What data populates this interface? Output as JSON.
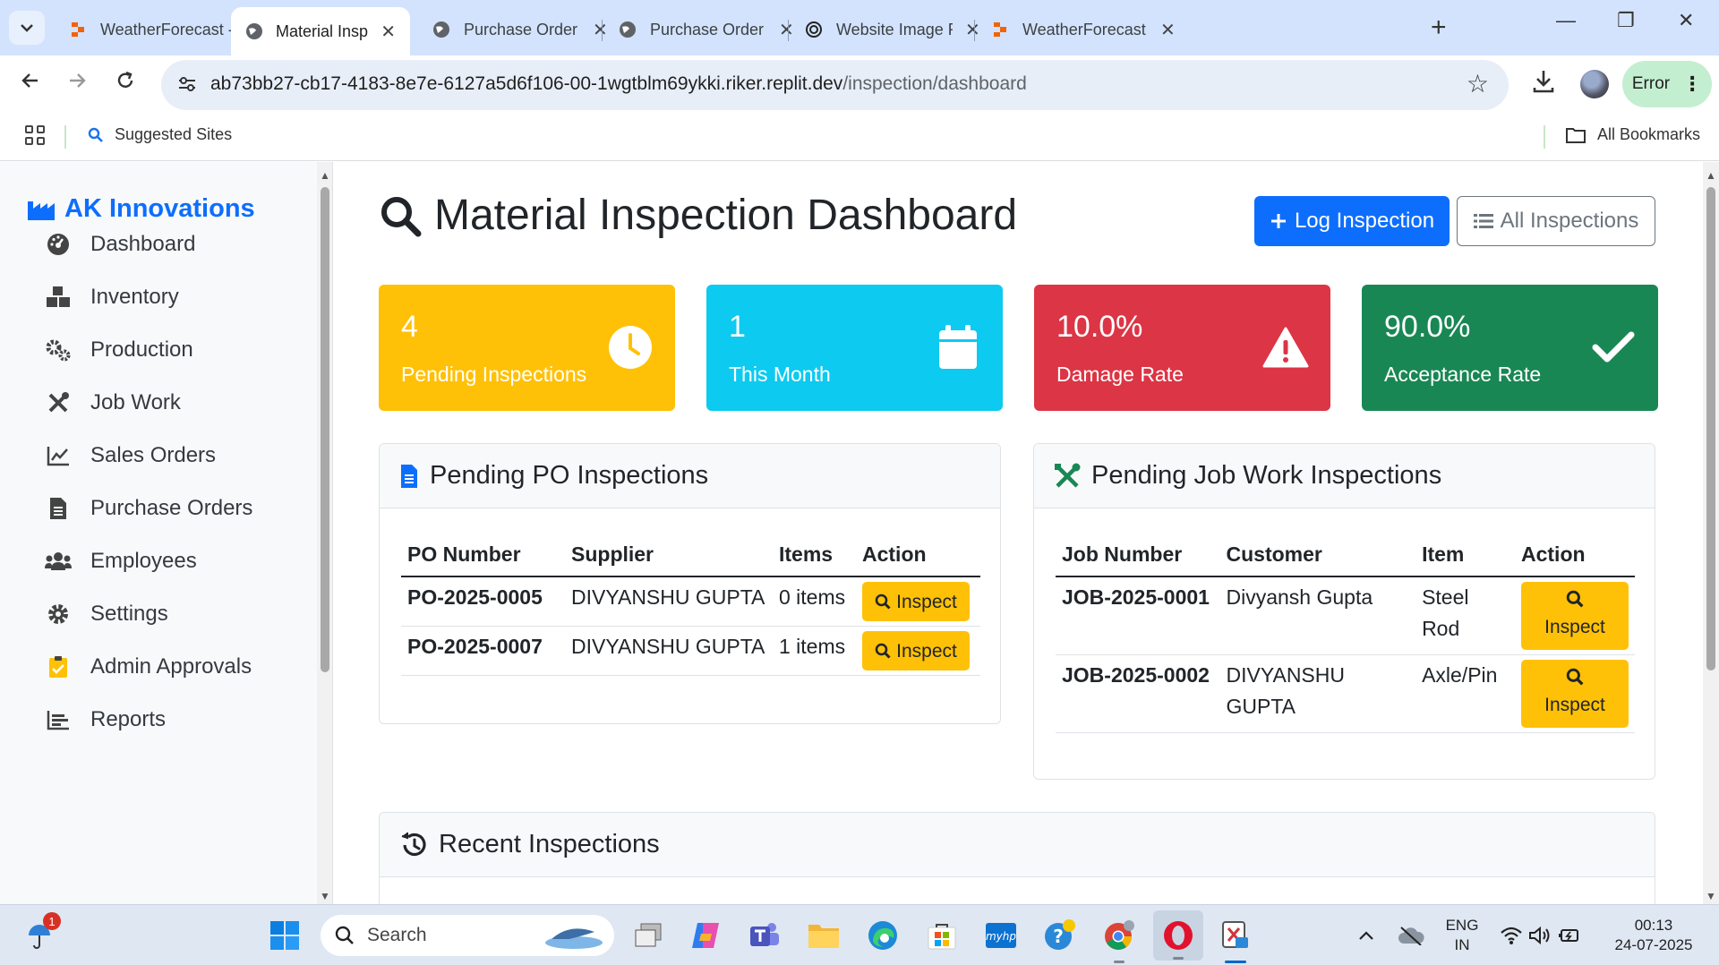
{
  "browser": {
    "tabs": [
      {
        "title": "WeatherForecast -",
        "icon": "replit-icon"
      },
      {
        "title": "Material Inspection",
        "icon": "globe-icon",
        "active": true
      },
      {
        "title": "Purchase Order - P",
        "icon": "globe-icon"
      },
      {
        "title": "Purchase Order - P",
        "icon": "globe-icon"
      },
      {
        "title": "Website Image Rec",
        "icon": "openai-icon"
      },
      {
        "title": "WeatherForecast -",
        "icon": "replit-icon"
      }
    ],
    "url_host": "ab73bb27-cb17-4183-8e7e-6127a5d6f106-00-1wgtblm69ykki.riker.replit.dev",
    "url_path": "/inspection/dashboard",
    "profile_status": "Error",
    "bookmarks": {
      "suggested": "Suggested Sites",
      "all": "All Bookmarks"
    }
  },
  "sidebar": {
    "brand": "AK Innovations",
    "items": [
      {
        "label": "Dashboard",
        "icon": "gauge-icon"
      },
      {
        "label": "Inventory",
        "icon": "boxes-icon"
      },
      {
        "label": "Production",
        "icon": "cogs-icon"
      },
      {
        "label": "Job Work",
        "icon": "tools-icon"
      },
      {
        "label": "Sales Orders",
        "icon": "line-chart-icon"
      },
      {
        "label": "Purchase Orders",
        "icon": "document-icon"
      },
      {
        "label": "Employees",
        "icon": "users-icon"
      },
      {
        "label": "Settings",
        "icon": "gear-icon"
      },
      {
        "label": "Admin Approvals",
        "icon": "clipboard-check-icon"
      },
      {
        "label": "Reports",
        "icon": "bar-chart-icon"
      }
    ]
  },
  "header": {
    "title": "Material Inspection Dashboard",
    "log_button": "Log Inspection",
    "all_button": "All Inspections"
  },
  "stats": [
    {
      "value": "4",
      "label": "Pending Inspections",
      "color": "#ffc107",
      "icon": "clock-icon"
    },
    {
      "value": "1",
      "label": "This Month",
      "color": "#0dcaf0",
      "icon": "calendar-icon"
    },
    {
      "value": "10.0%",
      "label": "Damage Rate",
      "color": "#dc3545",
      "icon": "warning-icon"
    },
    {
      "value": "90.0%",
      "label": "Acceptance Rate",
      "color": "#198754",
      "icon": "check-icon"
    }
  ],
  "po_card": {
    "title": "Pending PO Inspections",
    "columns": [
      "PO Number",
      "Supplier",
      "Items",
      "Action"
    ],
    "rows": [
      {
        "po": "PO-2025-0005",
        "supplier": "DIVYANSHU GUPTA",
        "items": "0 items",
        "action": "Inspect"
      },
      {
        "po": "PO-2025-0007",
        "supplier": "DIVYANSHU GUPTA",
        "items": "1 items",
        "action": "Inspect"
      }
    ]
  },
  "job_card": {
    "title": "Pending Job Work Inspections",
    "columns": [
      "Job Number",
      "Customer",
      "Item",
      "Action"
    ],
    "rows": [
      {
        "job": "JOB-2025-0001",
        "customer": "Divyansh Gupta",
        "item": "Steel Rod",
        "action": "Inspect"
      },
      {
        "job": "JOB-2025-0002",
        "customer": "DIVYANSHU GUPTA",
        "item": "Axle/Pin",
        "action": "Inspect"
      }
    ]
  },
  "recent_card": {
    "title": "Recent Inspections"
  },
  "taskbar": {
    "search_placeholder": "Search",
    "notification_count": "1",
    "lang_line1": "ENG",
    "lang_line2": "IN",
    "time": "00:13",
    "date": "24-07-2025"
  }
}
